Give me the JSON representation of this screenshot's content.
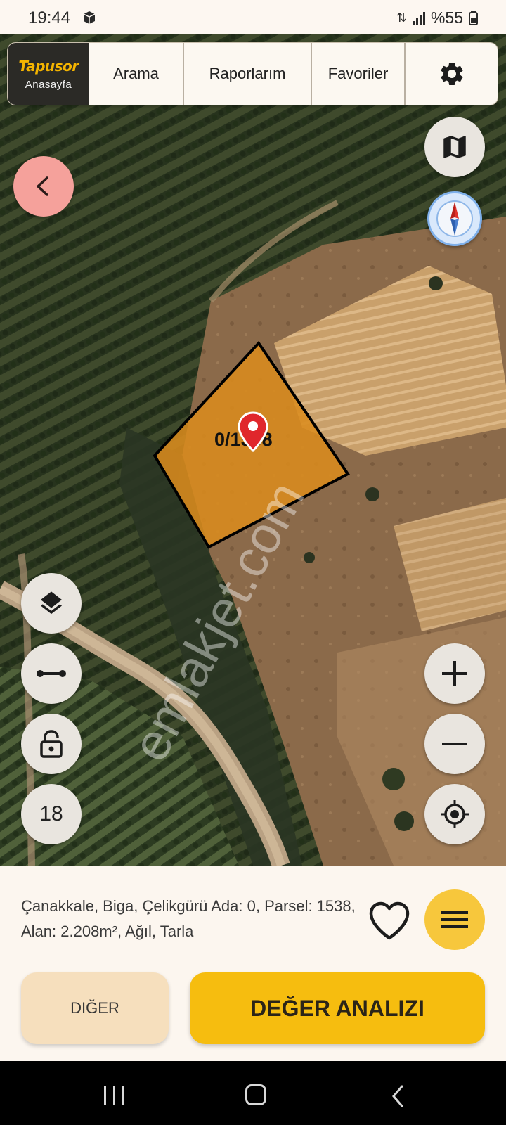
{
  "status_bar": {
    "time": "19:44",
    "battery": "%55"
  },
  "nav": {
    "logo": "Tapusor",
    "home": "Anasayfa",
    "search": "Arama",
    "reports": "Raporlarım",
    "favorites": "Favoriler"
  },
  "map": {
    "parcel_label": "0/1538",
    "zoom_level": "18",
    "watermark": "emlakjet.com"
  },
  "parcel": {
    "info": "Çanakkale, Biga, Çelikgürü Ada: 0, Parsel: 1538, Alan: 2.208m², Ağıl, Tarla"
  },
  "actions": {
    "other": "DIĞER",
    "value_analysis": "DEĞER ANALIZI"
  },
  "colors": {
    "accent_yellow": "#F6BD0F",
    "parcel_fill": "#D98B1E",
    "back_button": "#F5A19B",
    "marker_red": "#E0272C"
  },
  "icons": [
    "settings-icon",
    "map-icon",
    "compass-icon",
    "back-arrow-icon",
    "layers-icon",
    "measure-icon",
    "lock-icon",
    "zoom-in-icon",
    "zoom-out-icon",
    "locate-icon",
    "heart-icon",
    "menu-icon",
    "location-pin-icon"
  ]
}
